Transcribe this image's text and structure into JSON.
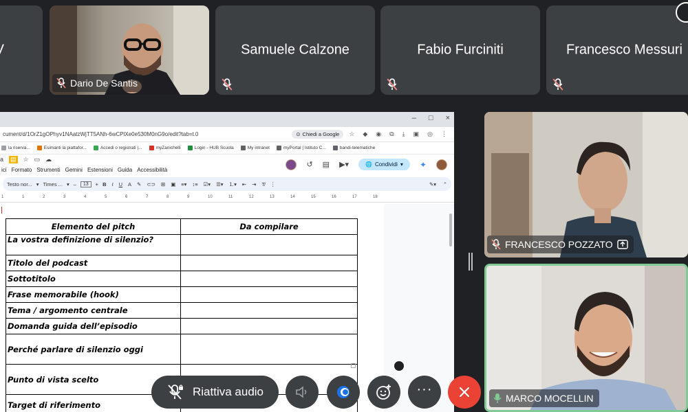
{
  "participants_top": [
    {
      "name": "V",
      "muted": true
    },
    {
      "name": "Dario De Santis",
      "muted": true,
      "video": true
    },
    {
      "name": "Samuele Calzone",
      "muted": true
    },
    {
      "name": "Fabio Furciniti",
      "muted": true
    },
    {
      "name": "Francesco Messuri",
      "muted": true
    }
  ],
  "browser": {
    "url": "cument/d/1OrZ1gOPhyv1NAatzWjTT5ANh-6wCPlXe0e530M0nG9o/edit?tab=t.0",
    "chiedi_label": "Chiedi a Google",
    "bookmarks": [
      {
        "label": "la riserva...",
        "color": "#9aa0a6"
      },
      {
        "label": "Esimanti la piattafor...",
        "color": "#e37400"
      },
      {
        "label": "Accedi o registrati |...",
        "color": "#34a853"
      },
      {
        "label": "myZanichelli",
        "color": "#d93025"
      },
      {
        "label": "Login - HUB Scuola",
        "color": "#1e8e3e"
      },
      {
        "label": "My intranet",
        "color": "#5f6368"
      },
      {
        "label": "myPortal | Istituto C...",
        "color": "#5f6368"
      },
      {
        "label": "bandi-telematiche",
        "color": "#5f6368"
      }
    ],
    "window_controls": [
      "–",
      "□",
      "×"
    ]
  },
  "docs": {
    "menu": [
      "ici",
      "Formato",
      "Strumenti",
      "Gemini",
      "Estensioni",
      "Guida",
      "Accessibilità"
    ],
    "share_label": "Condividi",
    "toolbar": {
      "style": "Testo nor...",
      "font": "Times ...",
      "size": "13",
      "ruler_marks": [
        "1",
        "1",
        "2",
        "3",
        "4",
        "5",
        "6",
        "7",
        "8",
        "9",
        "10",
        "11",
        "12",
        "13",
        "14",
        "15",
        "16",
        "17",
        "18"
      ]
    }
  },
  "pitch_table": {
    "headers": [
      "Elemento del pitch",
      "Da compilare"
    ],
    "rows": [
      {
        "label": "La vostra definizione di silenzio?",
        "h": 30,
        "valign": "top"
      },
      {
        "label": "Titolo del podcast",
        "h": 23
      },
      {
        "label": "Sottotitolo",
        "h": 23
      },
      {
        "label": "Frase memorabile (hook)",
        "h": 23
      },
      {
        "label": "Tema / argomento centrale",
        "h": 23
      },
      {
        "label": "Domanda guida dell’episodio",
        "h": 23
      },
      {
        "label": "Perché parlare di silenzio oggi",
        "h": 44
      },
      {
        "label": "Punto di vista scelto",
        "h": 44
      },
      {
        "label": "Target di riferimento",
        "h": 30
      }
    ]
  },
  "participants_right": [
    {
      "name": "FRANCESCO POZZATO",
      "muted": true,
      "present_icon": true
    },
    {
      "name": "MARCO MOCELLIN",
      "speaking": true
    }
  ],
  "controls": {
    "unmute_label": "Riattiva audio"
  },
  "colors": {
    "tile_bg": "#3c4043",
    "end_call": "#ea4335",
    "active_border": "#81c995"
  }
}
